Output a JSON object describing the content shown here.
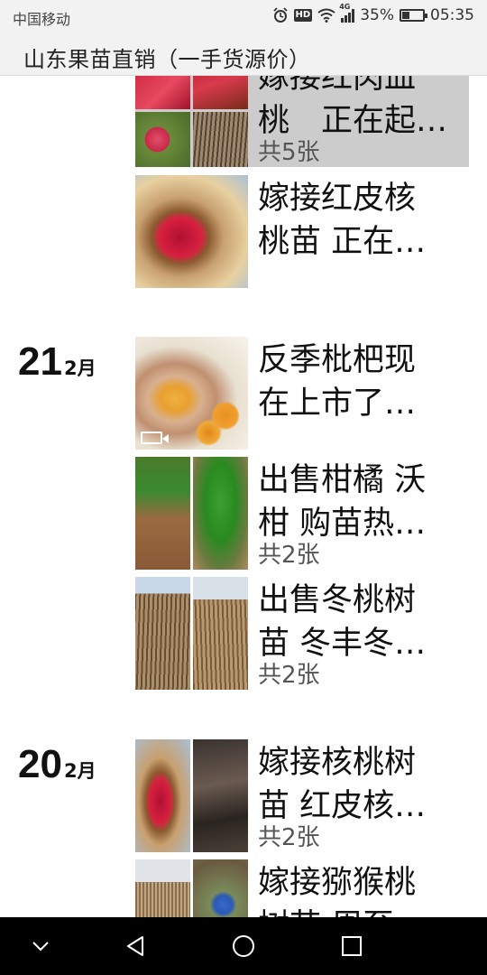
{
  "status_bar": {
    "carrier": "中国移动",
    "network": "4G",
    "hd": "HD",
    "battery": "35%",
    "battery_level": 0.35,
    "time": "05:35",
    "icons": [
      "alarm-icon",
      "hd-icon",
      "wifi-icon",
      "signal-icon",
      "battery-icon"
    ]
  },
  "header": {
    "title": "山东果苗直销（一手货源价）"
  },
  "posts": [
    {
      "line1": "嫁接红肉血",
      "line2": "桃　正在起…",
      "count": "共5张",
      "highlighted": true
    },
    {
      "line1": "嫁接红皮核",
      "line2": "桃苗  正在…",
      "count": ""
    },
    {
      "day": "21",
      "month": "2月",
      "line1": "反季枇杷现",
      "line2": "在上市了…",
      "count": "",
      "video": true
    },
    {
      "line1": "出售柑橘  沃",
      "line2": "柑  购苗热…",
      "count": "共2张"
    },
    {
      "line1": "出售冬桃树",
      "line2": "苗   冬丰冬…",
      "count": "共2张"
    },
    {
      "day": "20",
      "month": "2月",
      "line1": "嫁接核桃树",
      "line2": "苗  红皮核…",
      "count": "共2张"
    },
    {
      "line1": "嫁接猕猴桃",
      "line2": "树苗  周至…",
      "count": ""
    }
  ],
  "nav": {
    "icons": [
      "back-chevron-icon",
      "back-triangle-icon",
      "home-circle-icon",
      "recents-square-icon"
    ]
  }
}
